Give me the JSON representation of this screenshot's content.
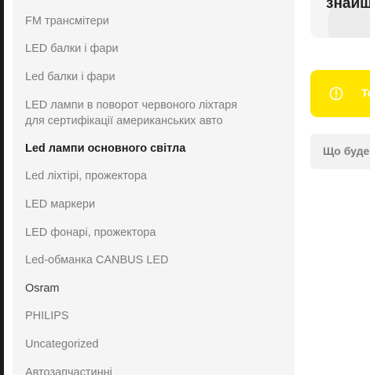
{
  "sidebar": {
    "categories": [
      {
        "label": "FM трансмітери"
      },
      {
        "label": "LED балки і фари"
      },
      {
        "label": "Led балки і фари"
      },
      {
        "label": "LED лампи в поворот червоного ліхтаря",
        "label_line2": "для сертифікації американських авто"
      },
      {
        "label": "Led лампи основного світла"
      },
      {
        "label": "Led ліхтірі, прожектора"
      },
      {
        "label": "LED маркери"
      },
      {
        "label": "LED фонарі, прожектора"
      },
      {
        "label": "Led-обманка CANBUS LED"
      },
      {
        "label": "Osram"
      },
      {
        "label": "PHILIPS"
      },
      {
        "label": "Uncategorized"
      },
      {
        "label": "Автозапчастинні"
      }
    ]
  },
  "top_card": {
    "title": "знайш"
  },
  "notice": {
    "text": "То",
    "icon": "info-icon",
    "color": "#ffe500"
  },
  "search": {
    "placeholder": "Що буде"
  }
}
